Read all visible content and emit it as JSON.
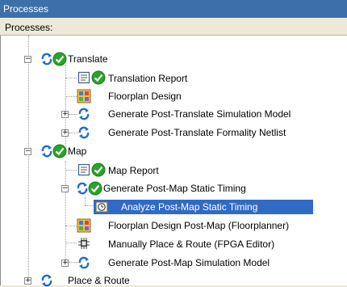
{
  "window": {
    "title": "Processes"
  },
  "header": {
    "label": "Processes:"
  },
  "colors": {
    "title_bg": "#3d6fa8",
    "selection": "#316ac5",
    "check": "#29a329",
    "refresh": "#1f6bd1"
  },
  "tree": {
    "translate": "Translate",
    "translation_report": "Translation Report",
    "floorplan_design": "Floorplan Design",
    "gen_post_translate_sim": "Generate Post-Translate Simulation Model",
    "gen_post_translate_formality": "Generate Post-Translate Formality Netlist",
    "map": "Map",
    "map_report": "Map Report",
    "gen_post_map_static_timing": "Generate Post-Map Static Timing",
    "analyze_post_map_static_timing": "Analyze Post-Map Static Timing",
    "floorplan_design_post_map": "Floorplan Design Post-Map (Floorplanner)",
    "manually_place_route": "Manually Place & Route (FPGA Editor)",
    "gen_post_map_sim": "Generate Post-Map Simulation Model",
    "place_route": "Place & Route"
  }
}
